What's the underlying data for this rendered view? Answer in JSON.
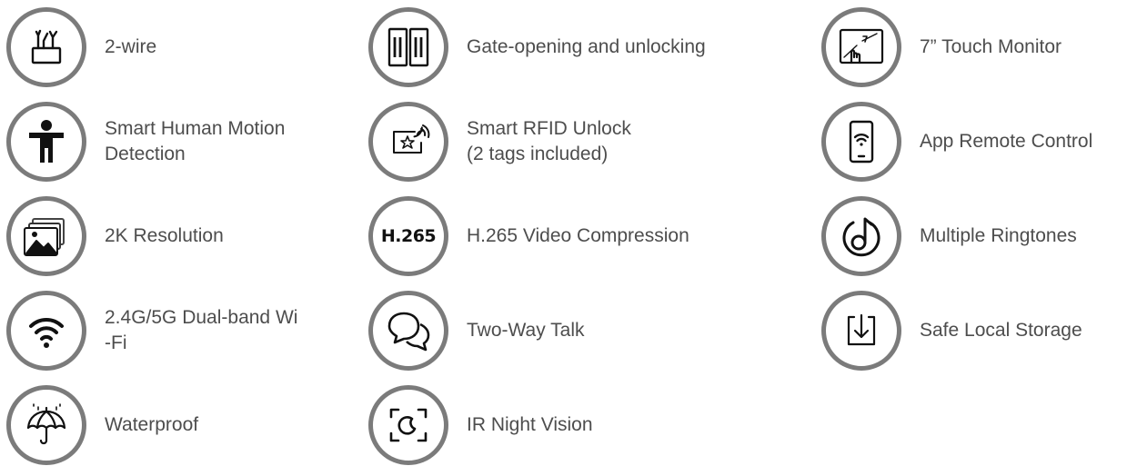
{
  "features": [
    {
      "id": "two-wire",
      "label": "2-wire",
      "icon": "two-wire-connector-icon"
    },
    {
      "id": "gate-opening",
      "label": "Gate-opening and unlocking",
      "icon": "gate-icon"
    },
    {
      "id": "touch-monitor",
      "label": "7” Touch Monitor",
      "icon": "touch-monitor-icon"
    },
    {
      "id": "motion-detection",
      "label": "Smart Human Motion\nDetection",
      "icon": "human-figure-icon"
    },
    {
      "id": "rfid-unlock",
      "label": "Smart RFID Unlock\n(2 tags included)",
      "icon": "rfid-card-icon"
    },
    {
      "id": "app-remote",
      "label": "App Remote Control",
      "icon": "phone-wifi-icon"
    },
    {
      "id": "resolution",
      "label": "2K Resolution",
      "icon": "image-stack-icon"
    },
    {
      "id": "h265",
      "label": "H.265 Video Compression",
      "icon": "h265-icon",
      "icon_text": "H.265"
    },
    {
      "id": "ringtones",
      "label": "Multiple Ringtones",
      "icon": "music-note-icon"
    },
    {
      "id": "wifi",
      "label": "2.4G/5G Dual-band Wi\n-Fi",
      "icon": "wifi-icon"
    },
    {
      "id": "two-way-talk",
      "label": "Two-Way Talk",
      "icon": "speech-bubbles-icon"
    },
    {
      "id": "storage",
      "label": "Safe Local Storage",
      "icon": "download-storage-icon"
    },
    {
      "id": "waterproof",
      "label": "Waterproof",
      "icon": "umbrella-rain-icon"
    },
    {
      "id": "night-vision",
      "label": "IR Night Vision",
      "icon": "night-vision-icon"
    }
  ],
  "colors": {
    "ring": "#7b7b7b",
    "text": "#4d4d4d",
    "icon": "#111111"
  }
}
